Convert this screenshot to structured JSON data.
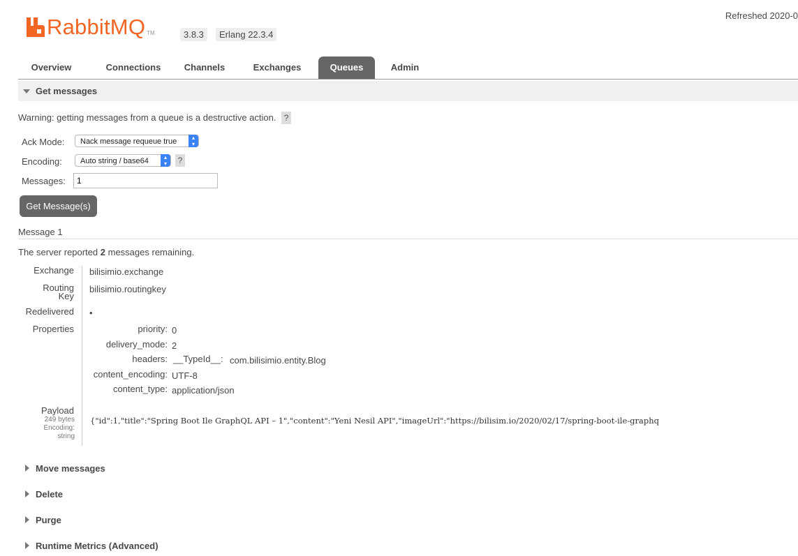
{
  "header": {
    "brand": "RabbitMQ",
    "tm": "TM",
    "version": "3.8.3",
    "erlang": "Erlang 22.3.4",
    "refreshed": "Refreshed 2020-0",
    "brand_color": "#f26522"
  },
  "tabs": [
    {
      "label": "Overview"
    },
    {
      "label": "Connections"
    },
    {
      "label": "Channels"
    },
    {
      "label": "Exchanges"
    },
    {
      "label": "Queues",
      "active": true
    },
    {
      "label": "Admin"
    }
  ],
  "get_messages": {
    "title": "Get messages",
    "warning": "Warning: getting messages from a queue is a destructive action.",
    "help": "?",
    "ack_mode_label": "Ack Mode:",
    "ack_mode_value": "Nack message requeue true",
    "encoding_label": "Encoding:",
    "encoding_value": "Auto string / base64",
    "messages_label": "Messages:",
    "messages_value": "1",
    "button": "Get Message(s)"
  },
  "message": {
    "title": "Message 1",
    "server_report_pre": "The server reported ",
    "remaining_count": "2",
    "server_report_post": " messages remaining.",
    "exchange_label": "Exchange",
    "exchange_value": "bilisimio.exchange",
    "routing_label_1": "Routing",
    "routing_label_2": "Key",
    "routing_value": "bilisimio.routingkey",
    "redelivered_label": "Redelivered",
    "redelivered_value": "•",
    "properties_label": "Properties",
    "properties": {
      "priority_label": "priority:",
      "priority_value": "0",
      "delivery_mode_label": "delivery_mode:",
      "delivery_mode_value": "2",
      "headers_label": "headers:",
      "headers_key": "__TypeId__:",
      "headers_value": "com.bilisimio.entity.Blog",
      "content_encoding_label": "content_encoding:",
      "content_encoding_value": "UTF-8",
      "content_type_label": "content_type:",
      "content_type_value": "application/json"
    },
    "payload_label": "Payload",
    "payload_size": "249 bytes",
    "payload_encoding_1": "Encoding:",
    "payload_encoding_2": "string",
    "payload_value": "{\"id\":1,\"title\":\"Spring Boot Ile GraphQL API – 1\",\"content\":\"Yeni Nesil API\",\"imageUrl\":\"https://bilisim.io/2020/02/17/spring-boot-ile-graphq"
  },
  "sections": [
    {
      "label": "Move messages"
    },
    {
      "label": "Delete"
    },
    {
      "label": "Purge"
    },
    {
      "label": "Runtime Metrics (Advanced)"
    }
  ]
}
